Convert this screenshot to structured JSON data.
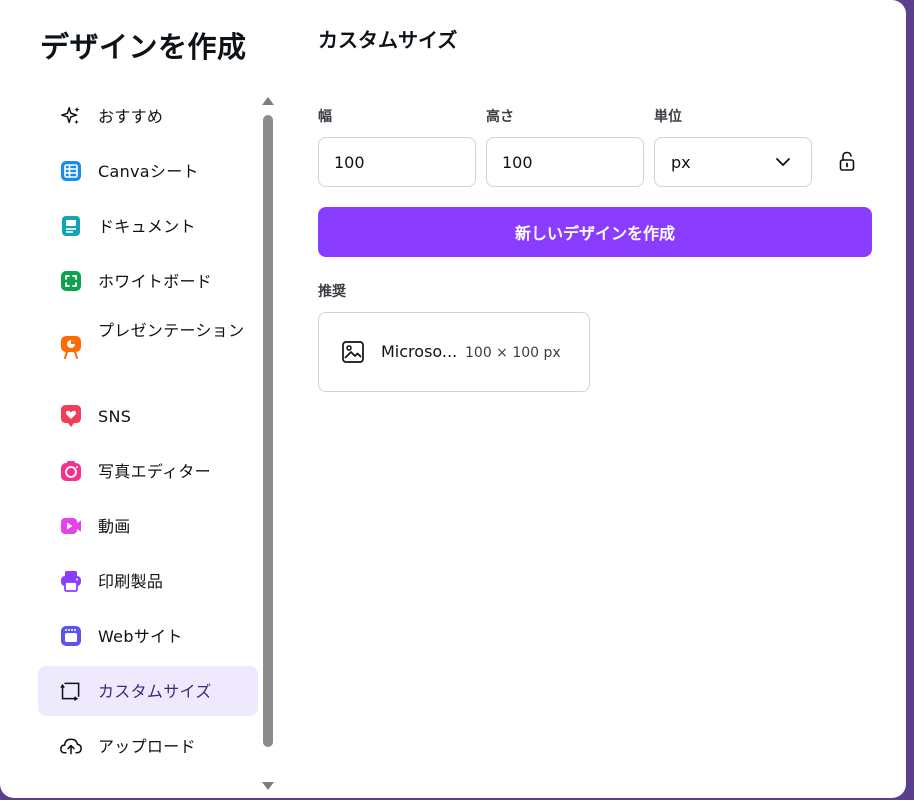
{
  "dialog": {
    "title": "デザインを作成"
  },
  "sidebar": {
    "items": [
      {
        "label": "おすすめ",
        "icon": "sparkles-icon"
      },
      {
        "label": "Canvaシート",
        "icon": "sheet-icon",
        "color": "#1a8cf0"
      },
      {
        "label": "ドキュメント",
        "icon": "document-icon",
        "color": "#13a3b5"
      },
      {
        "label": "ホワイトボード",
        "icon": "whiteboard-icon",
        "color": "#11a052"
      },
      {
        "label": "プレゼンテーション",
        "icon": "presentation-icon",
        "color": "#ff6b00"
      },
      {
        "label": "SNS",
        "icon": "heart-icon",
        "color": "#f03e5a"
      },
      {
        "label": "写真エディター",
        "icon": "camera-icon",
        "color": "#f5328c"
      },
      {
        "label": "動画",
        "icon": "video-icon",
        "color": "#e543e8"
      },
      {
        "label": "印刷製品",
        "icon": "printer-icon",
        "color": "#8b3dff"
      },
      {
        "label": "Webサイト",
        "icon": "website-icon",
        "color": "#5a55f0"
      },
      {
        "label": "カスタムサイズ",
        "icon": "custom-size-icon",
        "active": true
      },
      {
        "label": "アップロード",
        "icon": "cloud-upload-icon"
      }
    ]
  },
  "main": {
    "title": "カスタムサイズ",
    "width": {
      "label": "幅",
      "value": "100"
    },
    "height": {
      "label": "高さ",
      "value": "100"
    },
    "unit": {
      "label": "単位",
      "value": "px"
    },
    "create_label": "新しいデザインを作成",
    "recommended": {
      "label": "推奨",
      "items": [
        {
          "name": "Microso...",
          "size": "100 × 100 px",
          "icon": "image-icon"
        }
      ]
    }
  },
  "colors": {
    "accent": "#8b3dff",
    "active_bg": "#efe9fd"
  }
}
